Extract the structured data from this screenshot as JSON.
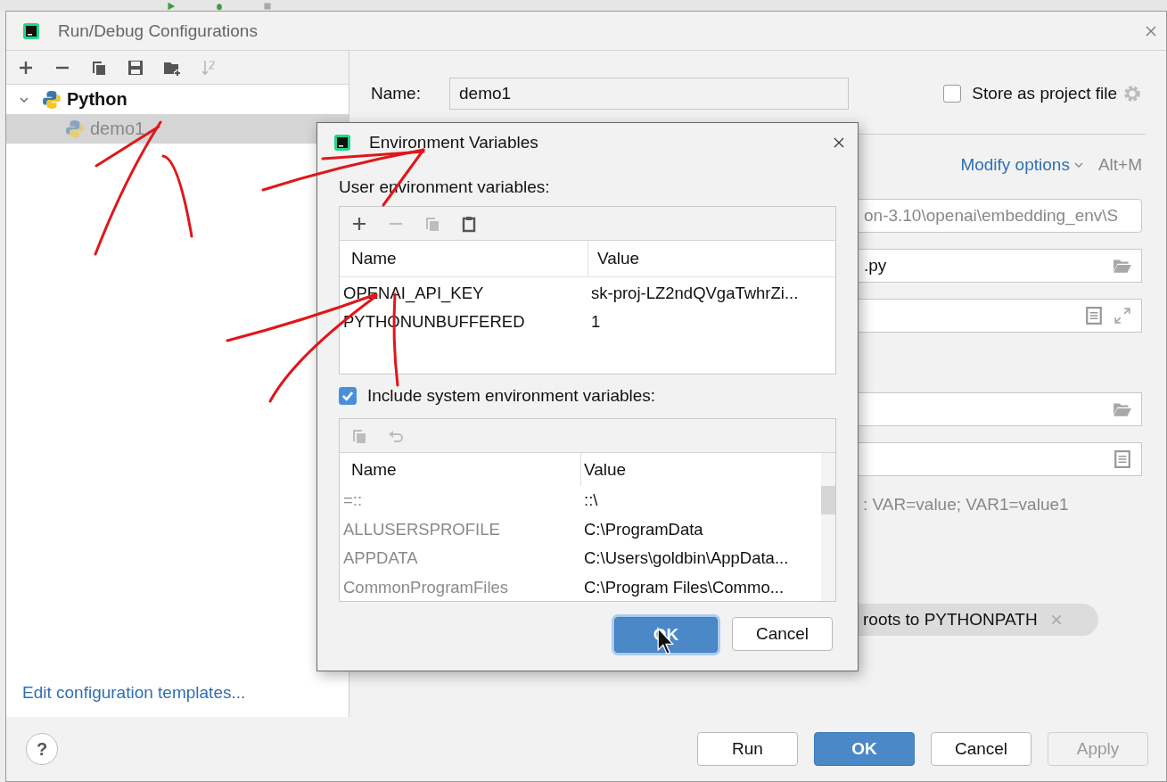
{
  "window": {
    "title": "Run/Debug Configurations"
  },
  "toolbar": [
    {
      "kind": "add",
      "disabled": false
    },
    {
      "kind": "remove",
      "disabled": false
    },
    {
      "kind": "copy",
      "disabled": false
    },
    {
      "kind": "save",
      "disabled": false
    },
    {
      "kind": "folder",
      "disabled": false
    },
    {
      "kind": "sort",
      "disabled": true
    }
  ],
  "tree": [
    {
      "label": "Python",
      "expanded": true,
      "selected": false,
      "children": [
        {
          "label": "demo1",
          "selected": true
        }
      ]
    }
  ],
  "templates_link": "Edit configuration templates...",
  "help_button": "?",
  "name_field": {
    "label": "Name:",
    "value": "demo1"
  },
  "store_as_project_file": {
    "label": "Store as project file",
    "checked": false
  },
  "modify_options": {
    "label": "Modify options",
    "shortcut": "Alt+M"
  },
  "fields": [
    {
      "kind": "dropdown",
      "value": "on-3.10\\openai\\embedding_env\\S"
    },
    {
      "kind": "folder",
      "value": ".py"
    },
    {
      "kind": "expand"
    },
    {
      "kind": "folder"
    },
    {
      "kind": "document"
    }
  ],
  "env_hint": ": VAR=value; VAR1=value1",
  "chip": {
    "label": "roots to PYTHONPATH"
  },
  "buttons": [
    {
      "label": "Run",
      "kind": "default"
    },
    {
      "label": "OK",
      "kind": "primary"
    },
    {
      "label": "Cancel",
      "kind": "default"
    },
    {
      "label": "Apply",
      "kind": "disabled"
    }
  ],
  "env_dialog": {
    "title": "Environment Variables",
    "user_label": "User environment variables:",
    "user_tools": [
      {
        "kind": "add",
        "disabled": false
      },
      {
        "kind": "remove",
        "disabled": true
      },
      {
        "kind": "copy",
        "disabled": true
      },
      {
        "kind": "paste",
        "disabled": false
      }
    ],
    "user_columns": [
      "Name",
      "Value"
    ],
    "user_rows": [
      {
        "name": "OPENAI_API_KEY",
        "value": "sk-proj-LZ2ndQVgaTwhrZi..."
      },
      {
        "name": "PYTHONUNBUFFERED",
        "value": "1"
      }
    ],
    "include_system": {
      "label": "Include system environment variables:",
      "checked": true
    },
    "system_tools": [
      {
        "kind": "copy",
        "disabled": true
      },
      {
        "kind": "undo",
        "disabled": true
      }
    ],
    "system_columns": [
      "Name",
      "Value"
    ],
    "system_rows": [
      {
        "name": "=::",
        "value": "::\\"
      },
      {
        "name": "ALLUSERSPROFILE",
        "value": "C:\\ProgramData"
      },
      {
        "name": "APPDATA",
        "value": "C:\\Users\\goldbin\\AppData..."
      },
      {
        "name": "CommonProgramFiles",
        "value": "C:\\Program Files\\Commo..."
      }
    ],
    "buttons": [
      {
        "label": "OK",
        "kind": "primary"
      },
      {
        "label": "Cancel",
        "kind": "default"
      }
    ]
  }
}
